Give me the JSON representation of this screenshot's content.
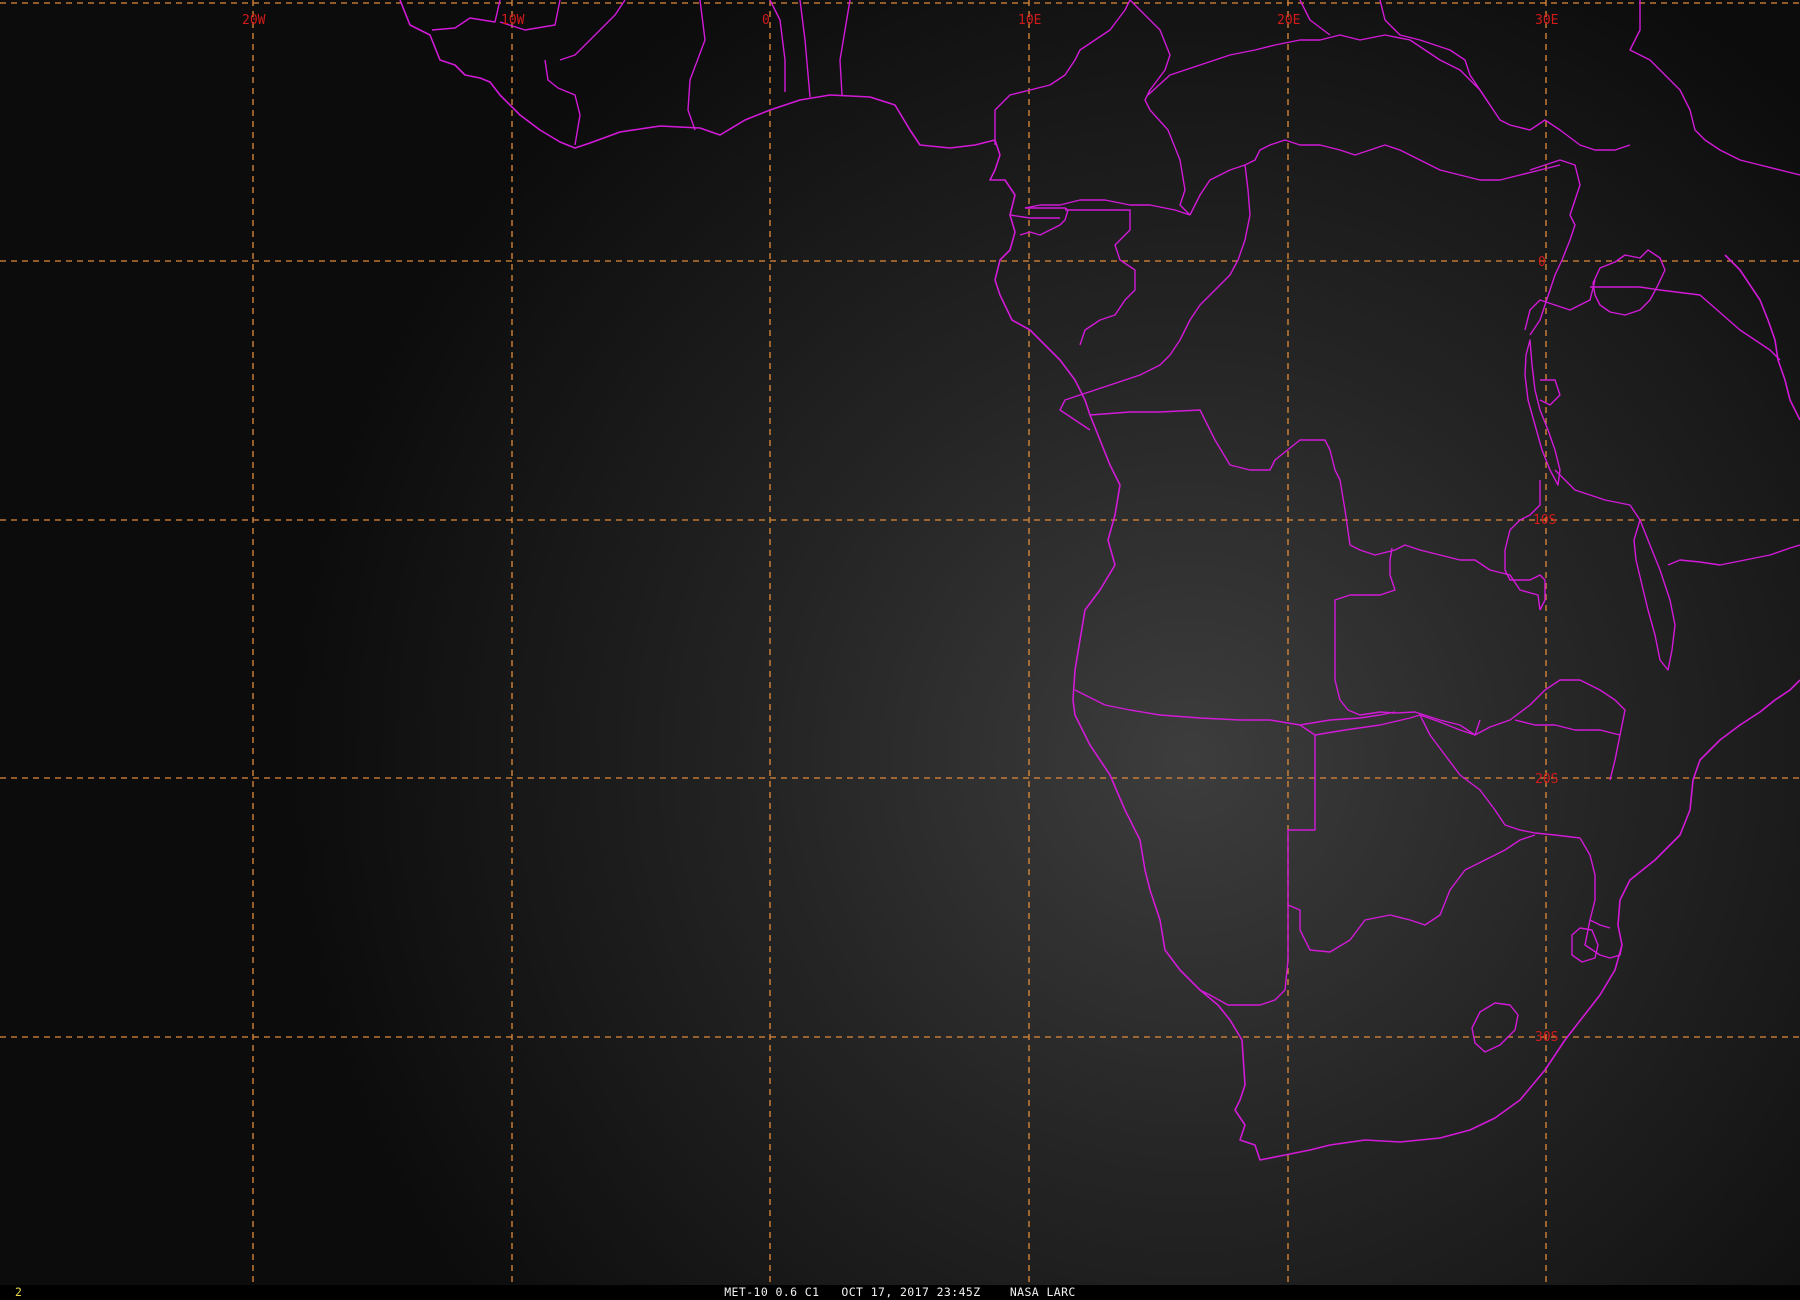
{
  "map": {
    "background_colors": [
      "#0c0c0c",
      "#3a3a3a"
    ],
    "line_color": "#d21ad8",
    "grid_color": "#e08a3a",
    "label_color": "#d11a1a",
    "longitude_labels": [
      "20W",
      "10W",
      "0",
      "10E",
      "20E",
      "30E"
    ],
    "latitude_labels": [
      "0",
      "10S",
      "20S",
      "30S"
    ]
  },
  "status_bar": {
    "frame_number": "2",
    "caption": "MET-10 0.6 C1   OCT 17, 2017 23:45Z    NASA LARC"
  }
}
